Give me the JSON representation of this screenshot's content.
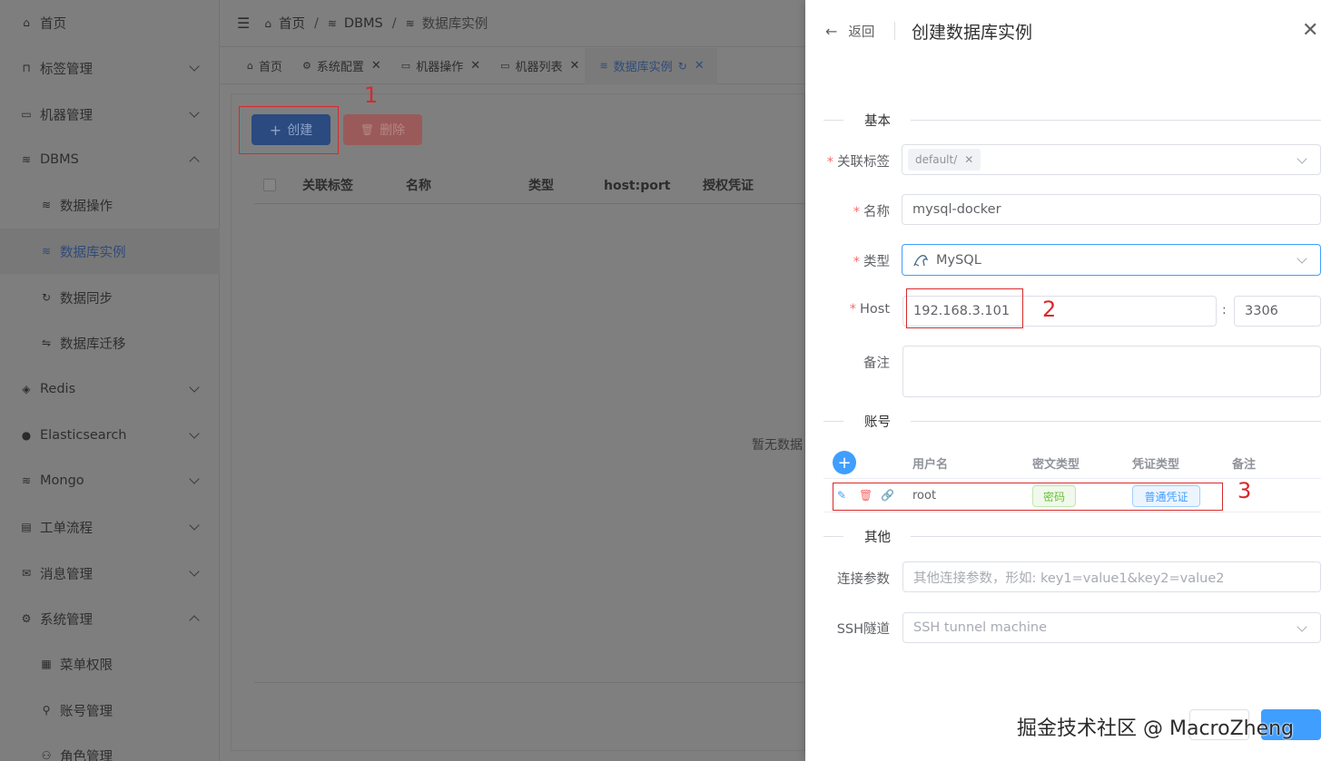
{
  "sidebar": {
    "items": [
      {
        "label": "首页",
        "icon": "home-icon"
      },
      {
        "label": "标签管理",
        "icon": "tag-icon"
      },
      {
        "label": "机器管理",
        "icon": "monitor-icon"
      },
      {
        "label": "DBMS",
        "icon": "database-icon"
      },
      {
        "label": "数据操作",
        "icon": "database-icon"
      },
      {
        "label": "数据库实例",
        "icon": "database-icon"
      },
      {
        "label": "数据同步",
        "icon": "sync-icon"
      },
      {
        "label": "数据库迁移",
        "icon": "transfer-icon"
      },
      {
        "label": "Redis",
        "icon": "redis-icon"
      },
      {
        "label": "Elasticsearch",
        "icon": "elasticsearch-icon"
      },
      {
        "label": "Mongo",
        "icon": "database-icon"
      },
      {
        "label": "工单流程",
        "icon": "clipboard-icon"
      },
      {
        "label": "消息管理",
        "icon": "mail-icon"
      },
      {
        "label": "系统管理",
        "icon": "gear-icon"
      },
      {
        "label": "菜单权限",
        "icon": "grid-icon"
      },
      {
        "label": "账号管理",
        "icon": "user-icon"
      },
      {
        "label": "角色管理",
        "icon": "users-icon"
      }
    ]
  },
  "header": {
    "breadcrumb": [
      "首页",
      "DBMS",
      "数据库实例"
    ],
    "separator": "/"
  },
  "tabs": [
    {
      "label": "首页"
    },
    {
      "label": "系统配置"
    },
    {
      "label": "机器操作"
    },
    {
      "label": "机器列表"
    },
    {
      "label": "数据库实例"
    }
  ],
  "toolbar": {
    "create_label": "创建",
    "delete_label": "删除"
  },
  "table": {
    "columns": [
      "关联标签",
      "名称",
      "类型",
      "host:port",
      "授权凭证"
    ],
    "empty_text": "暂无数据"
  },
  "annotations": [
    "1",
    "2",
    "3"
  ],
  "drawer": {
    "back_label": "返回",
    "title": "创建数据库实例",
    "sections": {
      "basic": "基本",
      "account": "账号",
      "other": "其他"
    },
    "labels": {
      "tags": "关联标签",
      "name": "名称",
      "type": "类型",
      "host": "Host",
      "remark": "备注",
      "params": "连接参数",
      "ssh": "SSH隧道"
    },
    "required_mark": "*",
    "values": {
      "tag": "default/",
      "name": "mysql-docker",
      "type": "MySQL",
      "host": "192.168.3.101",
      "port_sep": ":",
      "port": "3306"
    },
    "placeholders": {
      "params": "其他连接参数，形如: key1=value1&key2=value2",
      "ssh": "SSH tunnel machine"
    },
    "accounts": {
      "columns": [
        "用户名",
        "密文类型",
        "凭证类型",
        "备注"
      ],
      "rows": [
        {
          "username": "root",
          "cipher_type": "密码",
          "credential_type": "普通凭证",
          "remark": ""
        }
      ]
    }
  },
  "watermark": "掘金技术社区 @ MacroZheng"
}
